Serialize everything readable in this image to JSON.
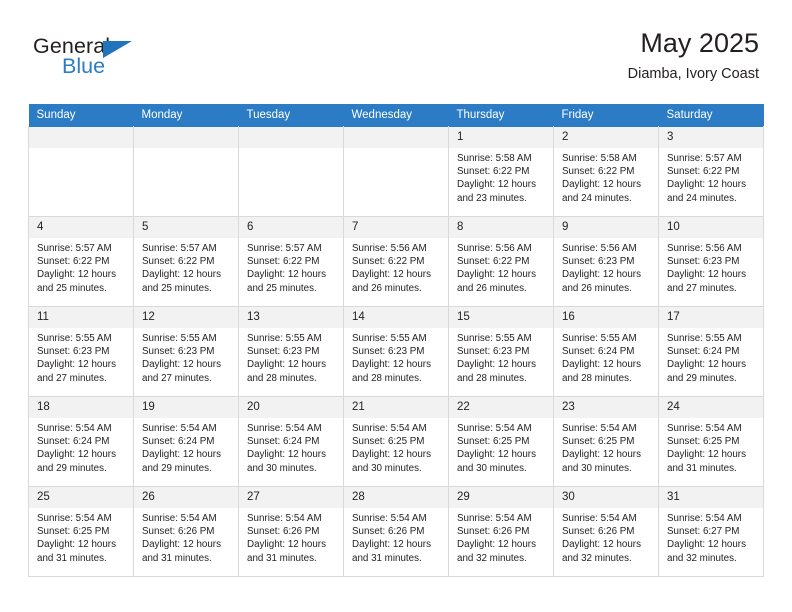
{
  "brand": {
    "name_top": "General",
    "name_bottom": "Blue"
  },
  "header": {
    "title": "May 2025",
    "location": "Diamba, Ivory Coast"
  },
  "colors": {
    "header_blue": "#2b7cc4",
    "row_band": "#f2f2f2",
    "grid_line": "#d9d9d9",
    "text": "#231f20"
  },
  "weekdays": [
    "Sunday",
    "Monday",
    "Tuesday",
    "Wednesday",
    "Thursday",
    "Friday",
    "Saturday"
  ],
  "weeks": [
    [
      {
        "day": "",
        "sunrise": "",
        "sunset": "",
        "daylight1": "",
        "daylight2": ""
      },
      {
        "day": "",
        "sunrise": "",
        "sunset": "",
        "daylight1": "",
        "daylight2": ""
      },
      {
        "day": "",
        "sunrise": "",
        "sunset": "",
        "daylight1": "",
        "daylight2": ""
      },
      {
        "day": "",
        "sunrise": "",
        "sunset": "",
        "daylight1": "",
        "daylight2": ""
      },
      {
        "day": "1",
        "sunrise": "Sunrise: 5:58 AM",
        "sunset": "Sunset: 6:22 PM",
        "daylight1": "Daylight: 12 hours",
        "daylight2": "and 23 minutes."
      },
      {
        "day": "2",
        "sunrise": "Sunrise: 5:58 AM",
        "sunset": "Sunset: 6:22 PM",
        "daylight1": "Daylight: 12 hours",
        "daylight2": "and 24 minutes."
      },
      {
        "day": "3",
        "sunrise": "Sunrise: 5:57 AM",
        "sunset": "Sunset: 6:22 PM",
        "daylight1": "Daylight: 12 hours",
        "daylight2": "and 24 minutes."
      }
    ],
    [
      {
        "day": "4",
        "sunrise": "Sunrise: 5:57 AM",
        "sunset": "Sunset: 6:22 PM",
        "daylight1": "Daylight: 12 hours",
        "daylight2": "and 25 minutes."
      },
      {
        "day": "5",
        "sunrise": "Sunrise: 5:57 AM",
        "sunset": "Sunset: 6:22 PM",
        "daylight1": "Daylight: 12 hours",
        "daylight2": "and 25 minutes."
      },
      {
        "day": "6",
        "sunrise": "Sunrise: 5:57 AM",
        "sunset": "Sunset: 6:22 PM",
        "daylight1": "Daylight: 12 hours",
        "daylight2": "and 25 minutes."
      },
      {
        "day": "7",
        "sunrise": "Sunrise: 5:56 AM",
        "sunset": "Sunset: 6:22 PM",
        "daylight1": "Daylight: 12 hours",
        "daylight2": "and 26 minutes."
      },
      {
        "day": "8",
        "sunrise": "Sunrise: 5:56 AM",
        "sunset": "Sunset: 6:22 PM",
        "daylight1": "Daylight: 12 hours",
        "daylight2": "and 26 minutes."
      },
      {
        "day": "9",
        "sunrise": "Sunrise: 5:56 AM",
        "sunset": "Sunset: 6:23 PM",
        "daylight1": "Daylight: 12 hours",
        "daylight2": "and 26 minutes."
      },
      {
        "day": "10",
        "sunrise": "Sunrise: 5:56 AM",
        "sunset": "Sunset: 6:23 PM",
        "daylight1": "Daylight: 12 hours",
        "daylight2": "and 27 minutes."
      }
    ],
    [
      {
        "day": "11",
        "sunrise": "Sunrise: 5:55 AM",
        "sunset": "Sunset: 6:23 PM",
        "daylight1": "Daylight: 12 hours",
        "daylight2": "and 27 minutes."
      },
      {
        "day": "12",
        "sunrise": "Sunrise: 5:55 AM",
        "sunset": "Sunset: 6:23 PM",
        "daylight1": "Daylight: 12 hours",
        "daylight2": "and 27 minutes."
      },
      {
        "day": "13",
        "sunrise": "Sunrise: 5:55 AM",
        "sunset": "Sunset: 6:23 PM",
        "daylight1": "Daylight: 12 hours",
        "daylight2": "and 28 minutes."
      },
      {
        "day": "14",
        "sunrise": "Sunrise: 5:55 AM",
        "sunset": "Sunset: 6:23 PM",
        "daylight1": "Daylight: 12 hours",
        "daylight2": "and 28 minutes."
      },
      {
        "day": "15",
        "sunrise": "Sunrise: 5:55 AM",
        "sunset": "Sunset: 6:23 PM",
        "daylight1": "Daylight: 12 hours",
        "daylight2": "and 28 minutes."
      },
      {
        "day": "16",
        "sunrise": "Sunrise: 5:55 AM",
        "sunset": "Sunset: 6:24 PM",
        "daylight1": "Daylight: 12 hours",
        "daylight2": "and 28 minutes."
      },
      {
        "day": "17",
        "sunrise": "Sunrise: 5:55 AM",
        "sunset": "Sunset: 6:24 PM",
        "daylight1": "Daylight: 12 hours",
        "daylight2": "and 29 minutes."
      }
    ],
    [
      {
        "day": "18",
        "sunrise": "Sunrise: 5:54 AM",
        "sunset": "Sunset: 6:24 PM",
        "daylight1": "Daylight: 12 hours",
        "daylight2": "and 29 minutes."
      },
      {
        "day": "19",
        "sunrise": "Sunrise: 5:54 AM",
        "sunset": "Sunset: 6:24 PM",
        "daylight1": "Daylight: 12 hours",
        "daylight2": "and 29 minutes."
      },
      {
        "day": "20",
        "sunrise": "Sunrise: 5:54 AM",
        "sunset": "Sunset: 6:24 PM",
        "daylight1": "Daylight: 12 hours",
        "daylight2": "and 30 minutes."
      },
      {
        "day": "21",
        "sunrise": "Sunrise: 5:54 AM",
        "sunset": "Sunset: 6:25 PM",
        "daylight1": "Daylight: 12 hours",
        "daylight2": "and 30 minutes."
      },
      {
        "day": "22",
        "sunrise": "Sunrise: 5:54 AM",
        "sunset": "Sunset: 6:25 PM",
        "daylight1": "Daylight: 12 hours",
        "daylight2": "and 30 minutes."
      },
      {
        "day": "23",
        "sunrise": "Sunrise: 5:54 AM",
        "sunset": "Sunset: 6:25 PM",
        "daylight1": "Daylight: 12 hours",
        "daylight2": "and 30 minutes."
      },
      {
        "day": "24",
        "sunrise": "Sunrise: 5:54 AM",
        "sunset": "Sunset: 6:25 PM",
        "daylight1": "Daylight: 12 hours",
        "daylight2": "and 31 minutes."
      }
    ],
    [
      {
        "day": "25",
        "sunrise": "Sunrise: 5:54 AM",
        "sunset": "Sunset: 6:25 PM",
        "daylight1": "Daylight: 12 hours",
        "daylight2": "and 31 minutes."
      },
      {
        "day": "26",
        "sunrise": "Sunrise: 5:54 AM",
        "sunset": "Sunset: 6:26 PM",
        "daylight1": "Daylight: 12 hours",
        "daylight2": "and 31 minutes."
      },
      {
        "day": "27",
        "sunrise": "Sunrise: 5:54 AM",
        "sunset": "Sunset: 6:26 PM",
        "daylight1": "Daylight: 12 hours",
        "daylight2": "and 31 minutes."
      },
      {
        "day": "28",
        "sunrise": "Sunrise: 5:54 AM",
        "sunset": "Sunset: 6:26 PM",
        "daylight1": "Daylight: 12 hours",
        "daylight2": "and 31 minutes."
      },
      {
        "day": "29",
        "sunrise": "Sunrise: 5:54 AM",
        "sunset": "Sunset: 6:26 PM",
        "daylight1": "Daylight: 12 hours",
        "daylight2": "and 32 minutes."
      },
      {
        "day": "30",
        "sunrise": "Sunrise: 5:54 AM",
        "sunset": "Sunset: 6:26 PM",
        "daylight1": "Daylight: 12 hours",
        "daylight2": "and 32 minutes."
      },
      {
        "day": "31",
        "sunrise": "Sunrise: 5:54 AM",
        "sunset": "Sunset: 6:27 PM",
        "daylight1": "Daylight: 12 hours",
        "daylight2": "and 32 minutes."
      }
    ]
  ]
}
